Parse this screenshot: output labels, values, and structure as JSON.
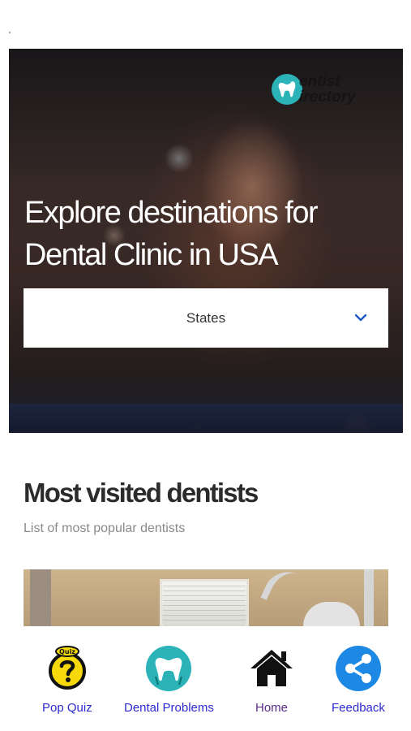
{
  "status_bar": {
    "indicator": "'"
  },
  "hero": {
    "logo_text_line1": "entist",
    "logo_text_line2": "irectory",
    "title_line1": "Explore destinations for",
    "title_line2": "Dental Clinic in USA",
    "states_select": {
      "selected": "States"
    }
  },
  "most_visited": {
    "title": "Most visited dentists",
    "subtitle": "List of most popular dentists"
  },
  "bottom_nav": {
    "items": [
      {
        "label": "Pop Quiz",
        "icon": "quiz-icon"
      },
      {
        "label": "Dental Problems",
        "icon": "tooth-icon"
      },
      {
        "label": "Home",
        "icon": "home-icon"
      },
      {
        "label": "Feedback",
        "icon": "share-icon"
      }
    ]
  },
  "colors": {
    "teal": "#2bb3b8",
    "nav_link": "#2c2ad0",
    "nav_active": "#5a2b8a",
    "share_blue": "#1e88e5",
    "quiz_yellow": "#f5d90a"
  }
}
